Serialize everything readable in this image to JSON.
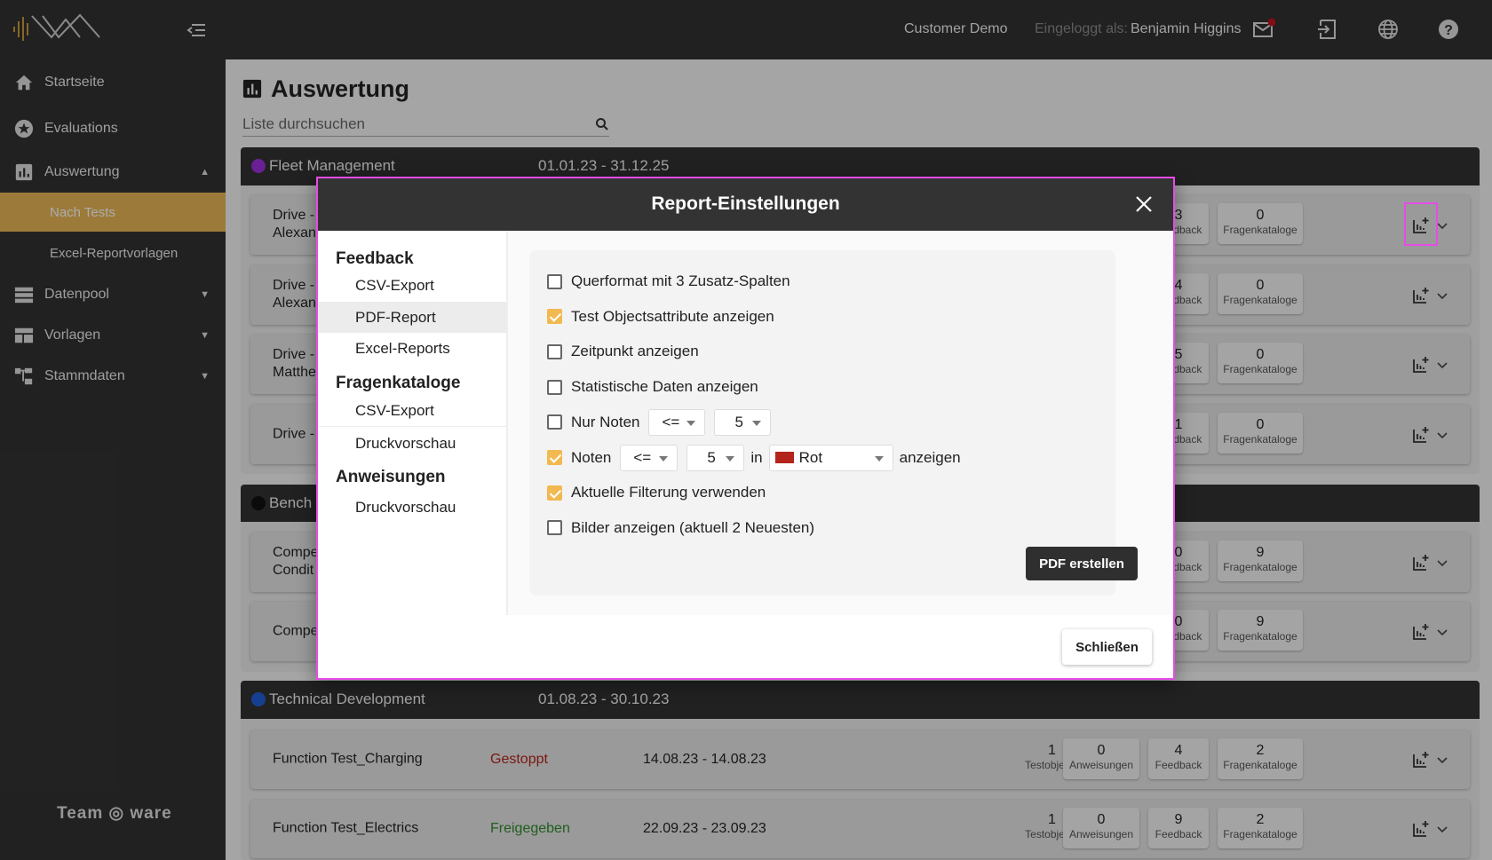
{
  "topbar": {
    "tenant": "Customer Demo",
    "logged_in_label": "Eingeloggt als:",
    "user": "Benjamin Higgins",
    "icons": [
      "mail-icon",
      "logout-icon",
      "globe-icon",
      "help-icon"
    ],
    "notification_color": "#c0141e"
  },
  "sidebar": {
    "items": [
      {
        "label": "Startseite",
        "icon": "home-icon"
      },
      {
        "label": "Evaluations",
        "icon": "star-icon"
      },
      {
        "label": "Auswertung",
        "icon": "chart-icon",
        "expanded": true,
        "children": [
          {
            "label": "Nach Tests",
            "active": true
          },
          {
            "label": "Excel-Reportvorlagen"
          }
        ]
      },
      {
        "label": "Datenpool",
        "icon": "database-icon"
      },
      {
        "label": "Vorlagen",
        "icon": "template-icon"
      },
      {
        "label": "Stammdaten",
        "icon": "hierarchy-icon"
      }
    ],
    "footer_logo": "Team ware",
    "accent": "#e6b455"
  },
  "main": {
    "title": "Auswertung",
    "search_placeholder": "Liste durchsuchen",
    "groups": [
      {
        "name": "Fleet Management",
        "dates": "01.01.23 - 31.12.25",
        "color": "#9b30d9",
        "rows": [
          {
            "name": "Drive -",
            "name2": "Alexan",
            "feedback": "3",
            "fragen": "0"
          },
          {
            "name": "Drive -",
            "name2": "Alexan",
            "feedback": "4",
            "fragen": "0"
          },
          {
            "name": "Drive -",
            "name2": "Matthe",
            "feedback": "5",
            "fragen": "0"
          },
          {
            "name": "Drive -",
            "name2": "",
            "feedback": "1",
            "fragen": "0"
          }
        ]
      },
      {
        "name": "Bench",
        "dates": "",
        "color": "#111111",
        "rows": [
          {
            "name": "Compe",
            "name2": "Condit",
            "feedback": "0",
            "fragen": "9"
          },
          {
            "name": "Compe",
            "name2": "",
            "feedback": "0",
            "fragen": "9"
          }
        ]
      },
      {
        "name": "Technical Development",
        "dates": "01.08.23 - 30.10.23",
        "color": "#1f5fd6",
        "rows": [
          {
            "name": "Function Test_Charging",
            "status": "Gestoppt",
            "status_color": "#b3241b",
            "dates": "14.08.23 - 14.08.23",
            "testobjekte": "1",
            "anweisungen": "0",
            "feedback": "4",
            "fragen": "2"
          },
          {
            "name": "Function Test_Electrics",
            "status": "Freigegeben",
            "status_color": "#2e8b2e",
            "dates": "22.09.23 - 23.09.23",
            "testobjekte": "1",
            "anweisungen": "0",
            "feedback": "9",
            "fragen": "2"
          }
        ]
      }
    ],
    "chip_labels": {
      "testobjekte": "Testobjekte",
      "anweisungen": "Anweisungen",
      "feedback": "Feedback",
      "feedback_partial": "back",
      "fragen": "Fragenkataloge"
    }
  },
  "modal": {
    "title": "Report-Einstellungen",
    "nav": {
      "feedback": "Feedback",
      "feedback_items": [
        "CSV-Export",
        "PDF-Report",
        "Excel-Reports"
      ],
      "fragen": "Fragenkataloge",
      "fragen_items": [
        "CSV-Export",
        "Druckvorschau"
      ],
      "anweisungen": "Anweisungen",
      "anweisungen_items": [
        "Druckvorschau"
      ],
      "active": "PDF-Report"
    },
    "options": [
      {
        "label": "Querformat mit 3 Zusatz-Spalten",
        "checked": false
      },
      {
        "label": "Test Objectsattribute anzeigen",
        "checked": true
      },
      {
        "label": "Zeitpunkt anzeigen",
        "checked": false
      },
      {
        "label": "Statistische Daten anzeigen",
        "checked": false
      },
      {
        "label": "Nur Noten",
        "checked": false,
        "op": "<=",
        "value": "5"
      },
      {
        "label": "Noten",
        "checked": true,
        "op": "<=",
        "value": "5",
        "in": "in",
        "color_label": "Rot",
        "color": "#b3241b",
        "suffix": "anzeigen"
      },
      {
        "label": "Aktuelle Filterung verwenden",
        "checked": true
      },
      {
        "label": "Bilder anzeigen (aktuell 2 Neuesten)",
        "checked": false
      }
    ],
    "pdf_button": "PDF erstellen",
    "close_button": "Schließen"
  }
}
